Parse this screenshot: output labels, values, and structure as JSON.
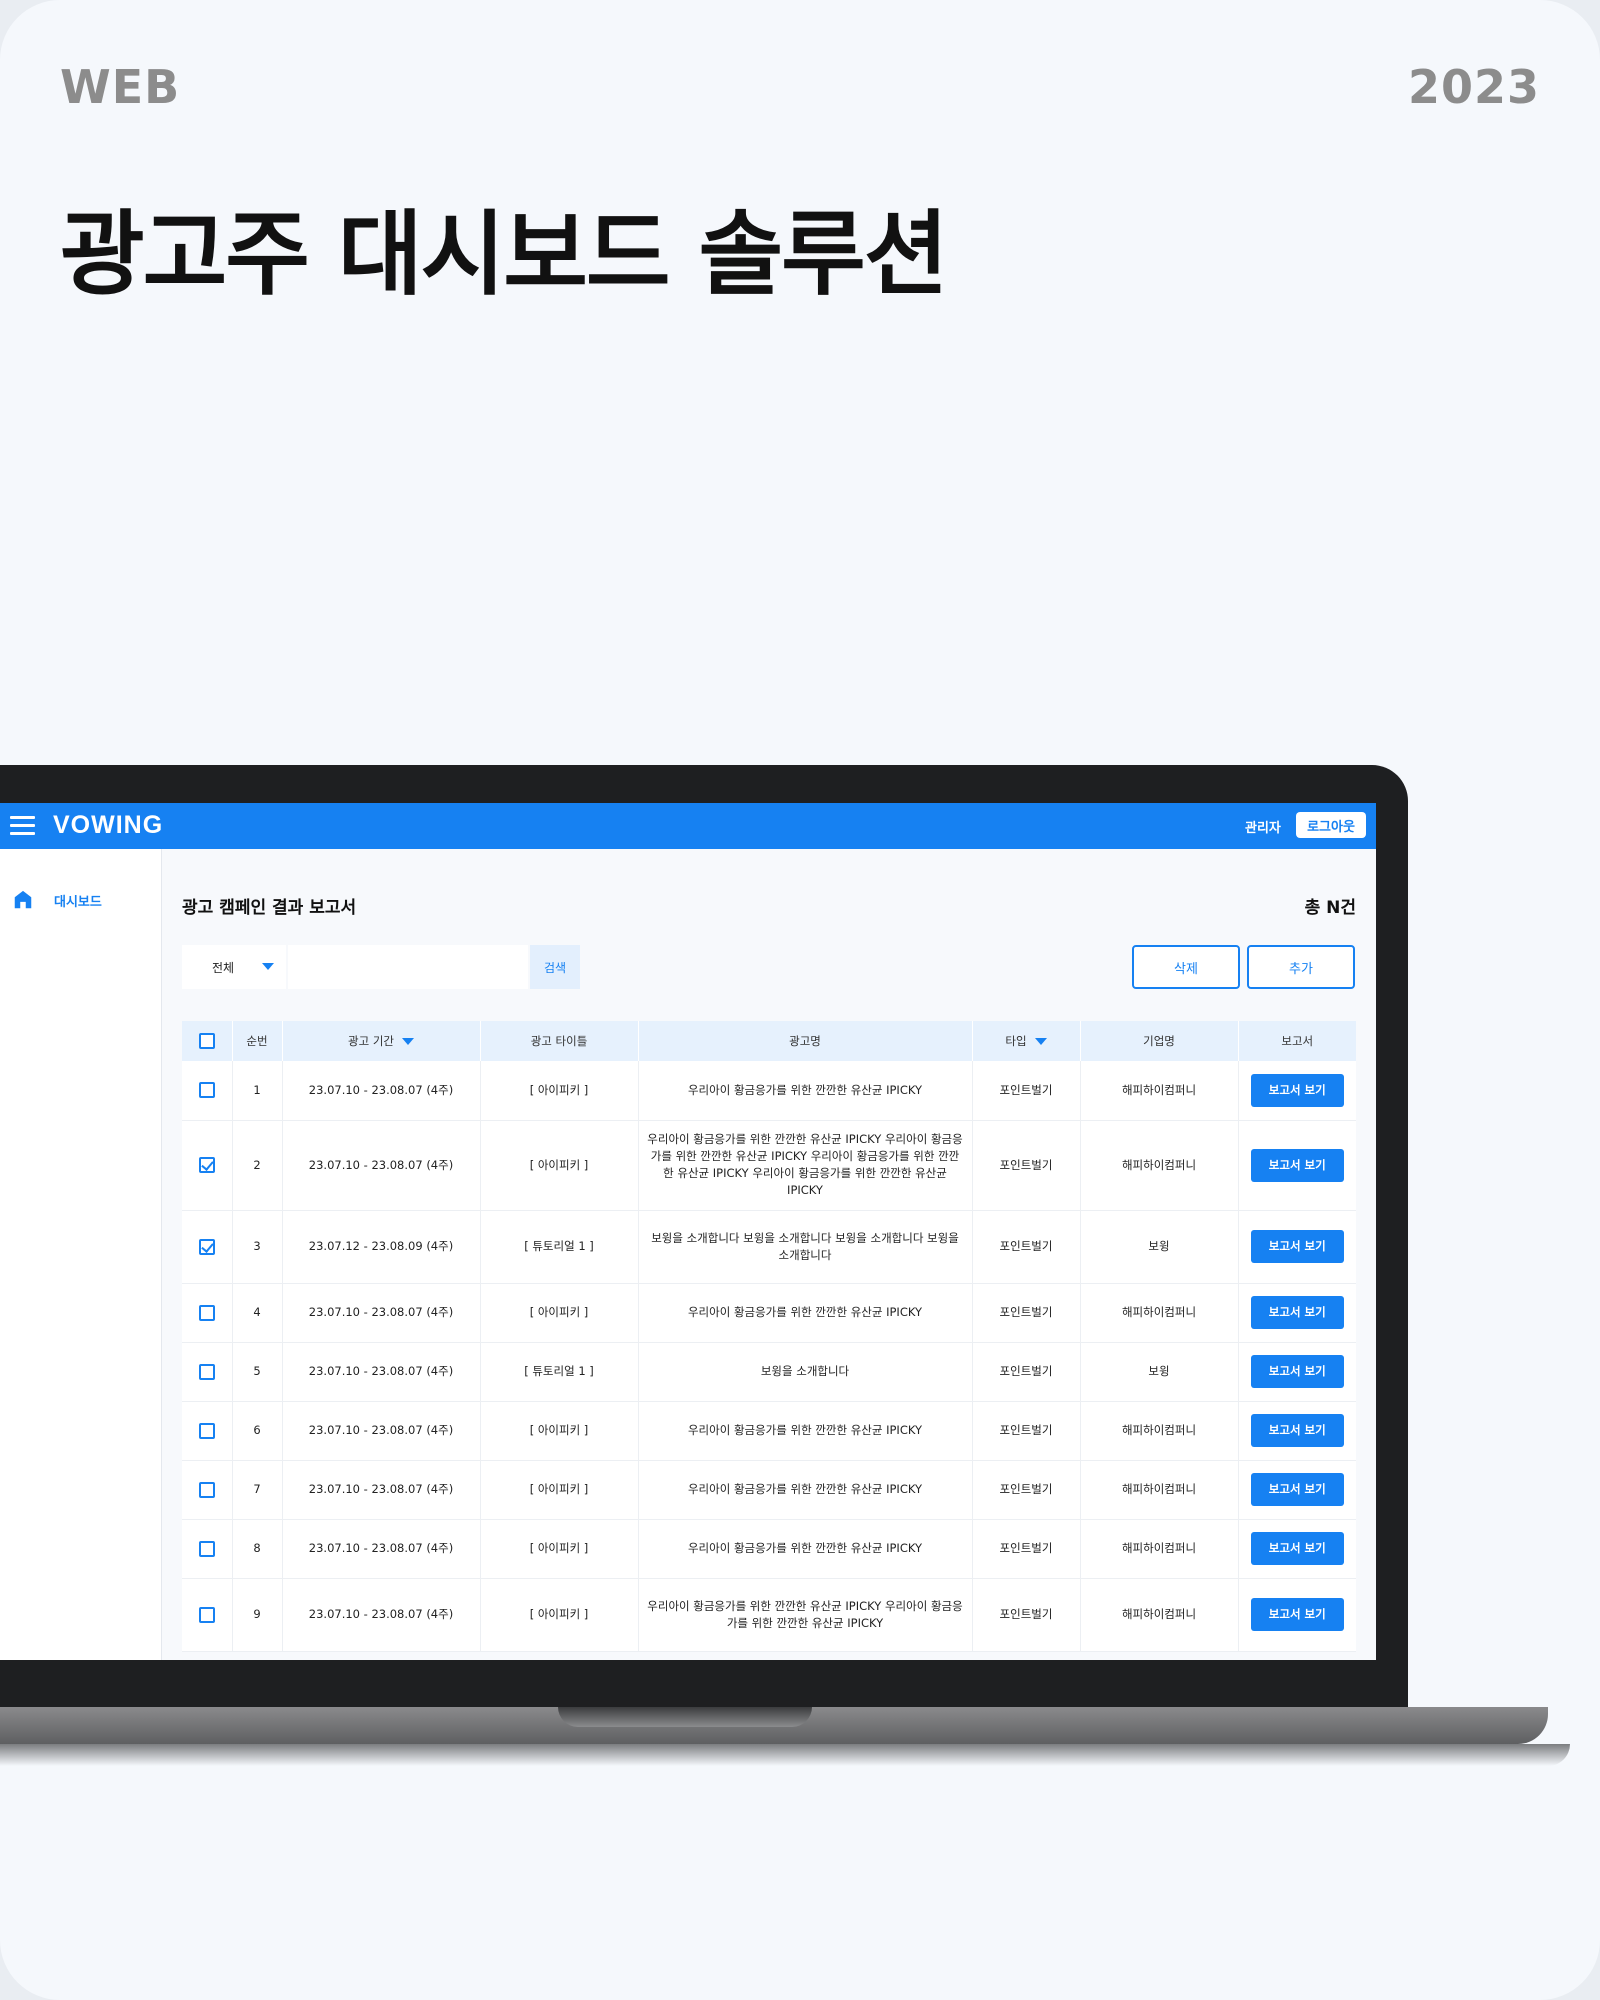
{
  "poster": {
    "tag_left": "WEB",
    "tag_right": "2023",
    "title": "광고주 대시보드 솔루션"
  },
  "header": {
    "brand": "VOWING",
    "admin_label": "관리자",
    "logout_label": "로그아웃"
  },
  "sidebar": {
    "items": [
      {
        "label": "대시보드",
        "icon": "home-icon",
        "active": true
      }
    ]
  },
  "main": {
    "page_title": "광고 캠페인 결과 보고서",
    "total_count": "총 N건",
    "filter": {
      "selected": "전체"
    },
    "search": {
      "value": "",
      "button_label": "검색"
    },
    "delete_label": "삭제",
    "add_label": "추가",
    "accent_color": "#1681f2"
  },
  "table": {
    "columns": [
      "순번",
      "광고 기간",
      "광고 타이틀",
      "광고명",
      "타입",
      "기업명",
      "보고서"
    ],
    "rows": [
      {
        "checked": false,
        "no": "1",
        "period": "23.07.10 - 23.08.07 (4주)",
        "ad_title": "[ 아이피키 ]",
        "ad_name": "우리아이 황금응가를 위한 깐깐한 유산균 IPICKY",
        "type": "포인트벌기",
        "company": "해피하이컴퍼니",
        "report": "보고서 보기"
      },
      {
        "checked": true,
        "no": "2",
        "period": "23.07.10 - 23.08.07 (4주)",
        "ad_title": "[ 아이피키 ]",
        "ad_name": "우리아이 황금응가를 위한 깐깐한 유산균 IPICKY 우리아이 황금응가를 위한 깐깐한 유산균 IPICKY  우리아이 황금응가를 위한 깐깐한 유산균 IPICKY 우리아이 황금응가를 위한 깐깐한 유산균 IPICKY",
        "type": "포인트벌기",
        "company": "해피하이컴퍼니",
        "report": "보고서 보기"
      },
      {
        "checked": true,
        "no": "3",
        "period": "23.07.12 - 23.08.09 (4주)",
        "ad_title": "[ 튜토리얼 1 ]",
        "ad_name": "보윙을 소개합니다 보윙을 소개합니다 보윙을 소개합니다 보윙을 소개합니다",
        "type": "포인트벌기",
        "company": "보윙",
        "report": "보고서 보기"
      },
      {
        "checked": false,
        "no": "4",
        "period": "23.07.10 - 23.08.07 (4주)",
        "ad_title": "[ 아이피키 ]",
        "ad_name": "우리아이 황금응가를 위한 깐깐한 유산균 IPICKY",
        "type": "포인트벌기",
        "company": "해피하이컴퍼니",
        "report": "보고서 보기"
      },
      {
        "checked": false,
        "no": "5",
        "period": "23.07.10 - 23.08.07 (4주)",
        "ad_title": "[ 튜토리얼 1 ]",
        "ad_name": "보윙을 소개합니다",
        "type": "포인트벌기",
        "company": "보윙",
        "report": "보고서 보기"
      },
      {
        "checked": false,
        "no": "6",
        "period": "23.07.10 - 23.08.07 (4주)",
        "ad_title": "[ 아이피키 ]",
        "ad_name": "우리아이 황금응가를 위한 깐깐한 유산균 IPICKY",
        "type": "포인트벌기",
        "company": "해피하이컴퍼니",
        "report": "보고서 보기"
      },
      {
        "checked": false,
        "no": "7",
        "period": "23.07.10 - 23.08.07 (4주)",
        "ad_title": "[ 아이피키 ]",
        "ad_name": "우리아이 황금응가를 위한 깐깐한 유산균 IPICKY",
        "type": "포인트벌기",
        "company": "해피하이컴퍼니",
        "report": "보고서 보기"
      },
      {
        "checked": false,
        "no": "8",
        "period": "23.07.10 - 23.08.07 (4주)",
        "ad_title": "[ 아이피키 ]",
        "ad_name": "우리아이 황금응가를 위한 깐깐한 유산균 IPICKY",
        "type": "포인트벌기",
        "company": "해피하이컴퍼니",
        "report": "보고서 보기"
      },
      {
        "checked": false,
        "no": "9",
        "period": "23.07.10 - 23.08.07 (4주)",
        "ad_title": "[ 아이피키 ]",
        "ad_name": "우리아이 황금응가를 위한 깐깐한 유산균 IPICKY 우리아이 황금응가를 위한 깐깐한 유산균 IPICKY",
        "type": "포인트벌기",
        "company": "해피하이컴퍼니",
        "report": "보고서 보기"
      }
    ]
  }
}
